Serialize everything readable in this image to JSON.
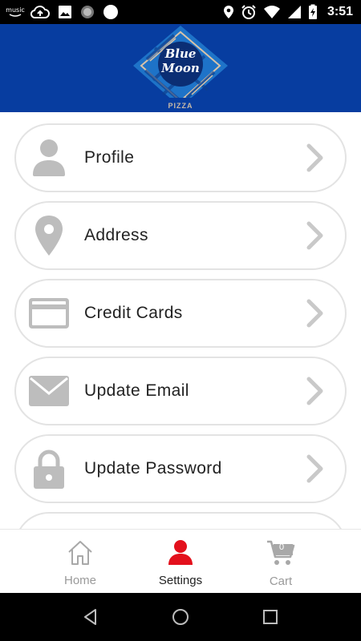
{
  "status_bar": {
    "music_label": "music",
    "time": "3:51"
  },
  "header": {
    "logo_line1": "Blue",
    "logo_line2": "Moon",
    "logo_line3": "PIZZA",
    "background": "#073da0"
  },
  "menu": {
    "items": [
      {
        "label": "Profile",
        "icon": "person-icon"
      },
      {
        "label": "Address",
        "icon": "location-pin-icon"
      },
      {
        "label": "Credit Cards",
        "icon": "credit-card-icon"
      },
      {
        "label": "Update Email",
        "icon": "envelope-icon"
      },
      {
        "label": "Update Password",
        "icon": "padlock-icon"
      }
    ]
  },
  "bottom_nav": {
    "home_label": "Home",
    "settings_label": "Settings",
    "cart_label": "Cart",
    "cart_count": "0",
    "active_color": "#e3101c"
  }
}
